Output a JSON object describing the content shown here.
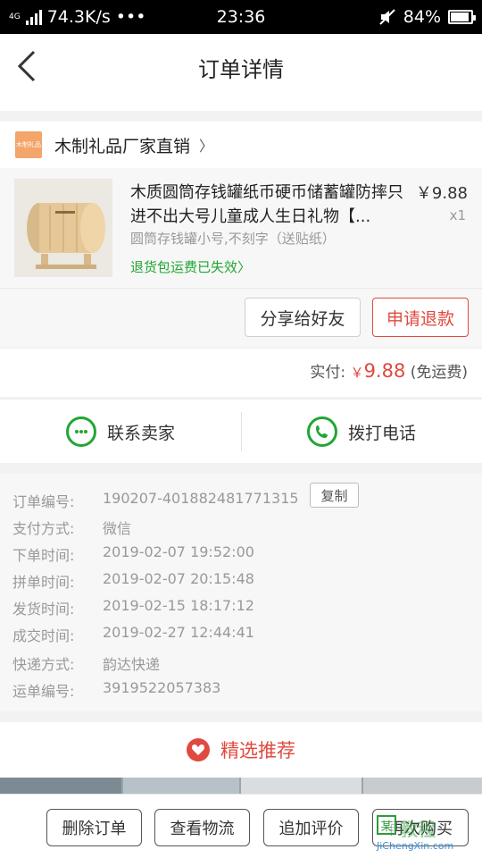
{
  "status_bar": {
    "network": "4G",
    "speed": "74.3K/s",
    "dots": "•••",
    "time": "23:36",
    "battery": "84%"
  },
  "header": {
    "title": "订单详情"
  },
  "shop": {
    "logo_text": "木制礼品",
    "name": "木制礼品厂家直销",
    "arrow": "〉"
  },
  "product": {
    "title": "木质圆筒存钱罐纸币硬币储蓄罐防摔只进不出大号儿童成人生日礼物【...",
    "price": "￥9.88",
    "quantity": "x1",
    "spec": "圆筒存钱罐小号,不刻字（送贴纸）",
    "notice": "退货包运费已失效〉"
  },
  "product_actions": {
    "share": "分享给好友",
    "refund": "申请退款"
  },
  "payment": {
    "label": "实付:",
    "currency": "￥",
    "amount": "9.88",
    "shipping_note": "(免运费)"
  },
  "contact": {
    "seller": "联系卖家",
    "phone": "拨打电话"
  },
  "order_info": {
    "copy_label": "复制",
    "rows": [
      {
        "key": "订单编号:",
        "value": "190207-401882481771315"
      },
      {
        "key": "支付方式:",
        "value": "微信"
      },
      {
        "key": "下单时间:",
        "value": "2019-02-07 19:52:00"
      },
      {
        "key": "拼单时间:",
        "value": "2019-02-07 20:15:48"
      },
      {
        "key": "发货时间:",
        "value": "2019-02-15 18:17:12"
      },
      {
        "key": "成交时间:",
        "value": "2019-02-27 12:44:41"
      },
      {
        "key": "快递方式:",
        "value": "韵达快递"
      },
      {
        "key": "运单编号:",
        "value": "3919522057383"
      }
    ]
  },
  "recommend": {
    "title": "精选推荐"
  },
  "bottom_bar": {
    "delete": "删除订单",
    "logistics": "查看物流",
    "review": "追加评价",
    "rebuy": "再次购买"
  },
  "watermark": {
    "char": "某",
    "text": "教程",
    "url": "JiChengXin.com"
  },
  "colors": {
    "accent_red": "#e0493f",
    "green": "#21a632"
  }
}
